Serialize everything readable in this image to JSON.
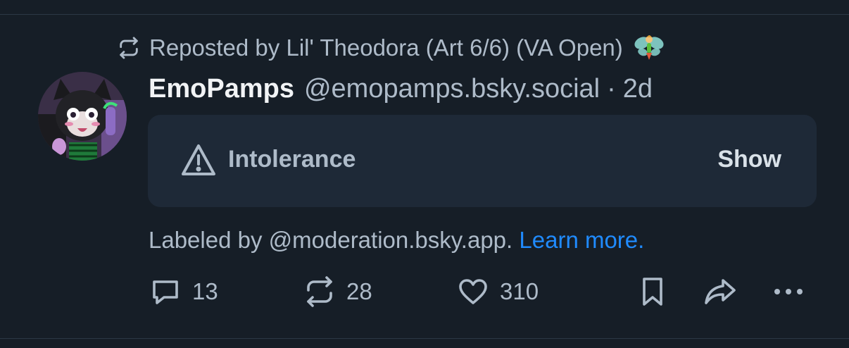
{
  "repost": {
    "prefix": "Reposted by",
    "name": "Lil' Theodora (Art 6/6) (VA Open)",
    "icon": "repost-icon",
    "emoji_icon": "fairy-emoji"
  },
  "post": {
    "display_name": "EmoPamps",
    "handle": "@emopamps.bsky.social",
    "separator": "·",
    "time": "2d",
    "avatar_icon": "avatar-image"
  },
  "content_warning": {
    "label": "Intolerance",
    "show_label": "Show",
    "icon": "warning-triangle-icon"
  },
  "moderation": {
    "labeled_text": "Labeled by @moderation.bsky.app.",
    "learn_more": "Learn more."
  },
  "actions": {
    "reply_count": "13",
    "repost_count": "28",
    "like_count": "310"
  },
  "colors": {
    "background": "#161e27",
    "card": "#1e2937",
    "muted_text": "#aebbc9",
    "primary_text": "#f1f3f5",
    "link": "#208bfe"
  }
}
